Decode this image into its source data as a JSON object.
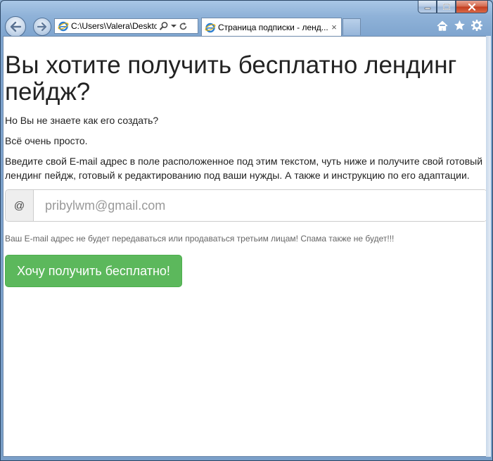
{
  "browser": {
    "address": "C:\\Users\\Valera\\Desktop",
    "tab_title": "Страница подписки - ленд...",
    "tab_close": "×"
  },
  "page": {
    "heading": "Вы хотите получить бесплатно лендинг пейдж?",
    "para1": "Но Вы не знаете как его создать?",
    "para2": "Всё очень просто.",
    "para3": "Введите свой E-mail адрес в поле расположенное под этим текстом, чуть ниже и получите свой готовый лендинг пейдж, готовый к редактированию под ваши нужды. А также и инструкцию по его адаптации.",
    "email_addon": "@",
    "email_placeholder": "pribylwm@gmail.com",
    "help_text": "Ваш E-mail адрес не будет передаваться или продаваться третьим лицам! Спама также не будет!!!",
    "cta_label": "Хочу получить бесплатно!"
  },
  "colors": {
    "cta": "#5cb85c"
  },
  "icons": [
    "back-arrow-icon",
    "forward-arrow-icon",
    "ie-logo-icon",
    "search-icon",
    "dropdown-icon",
    "refresh-icon",
    "home-icon",
    "favorites-star-icon",
    "gear-icon",
    "minimize-icon",
    "maximize-icon",
    "close-icon"
  ]
}
